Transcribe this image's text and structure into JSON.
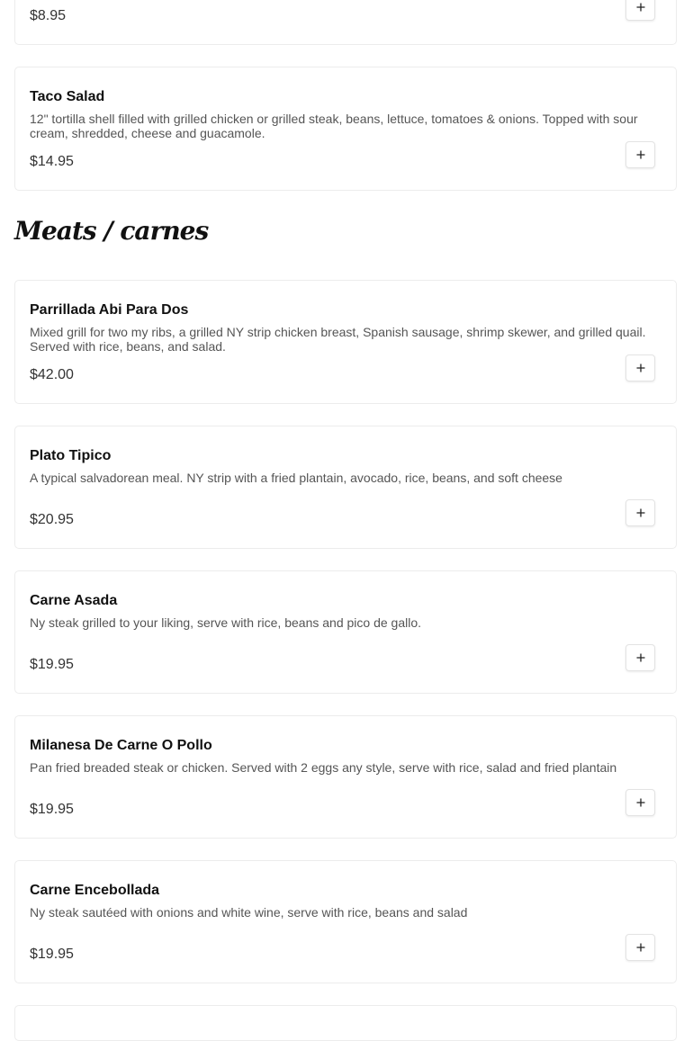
{
  "top_partial": {
    "price": "$8.95"
  },
  "taco_salad": {
    "name": "Taco Salad",
    "description": "12\" tortilla shell filled with grilled chicken or grilled steak, beans, lettuce, tomatoes & onions. Topped with sour cream, shredded, cheese and guacamole.",
    "price": "$14.95"
  },
  "section": {
    "title": "Meats / carnes"
  },
  "items": [
    {
      "name": "Parrillada Abi Para Dos",
      "description": "Mixed grill for two my ribs, a grilled NY strip chicken breast, Spanish sausage, shrimp skewer, and grilled quail. Served with rice, beans, and salad.",
      "price": "$42.00"
    },
    {
      "name": "Plato Tipico",
      "description": "A typical salvadorean meal. NY strip with a fried plantain, avocado, rice, beans, and soft cheese",
      "price": "$20.95"
    },
    {
      "name": "Carne Asada",
      "description": "Ny steak grilled to your liking, serve with rice, beans and pico de gallo.",
      "price": "$19.95"
    },
    {
      "name": "Milanesa De Carne O Pollo",
      "description": "Pan fried breaded steak or chicken. Served with 2 eggs any style, serve with rice, salad and fried plantain",
      "price": "$19.95"
    },
    {
      "name": "Carne Encebollada",
      "description": "Ny steak sautéed with onions and white wine, serve with rice, beans and salad",
      "price": "$19.95"
    }
  ],
  "icons": {
    "add": "plus-icon"
  },
  "colors": {
    "border": "#ececec",
    "text": "#111111",
    "muted": "#555555"
  }
}
